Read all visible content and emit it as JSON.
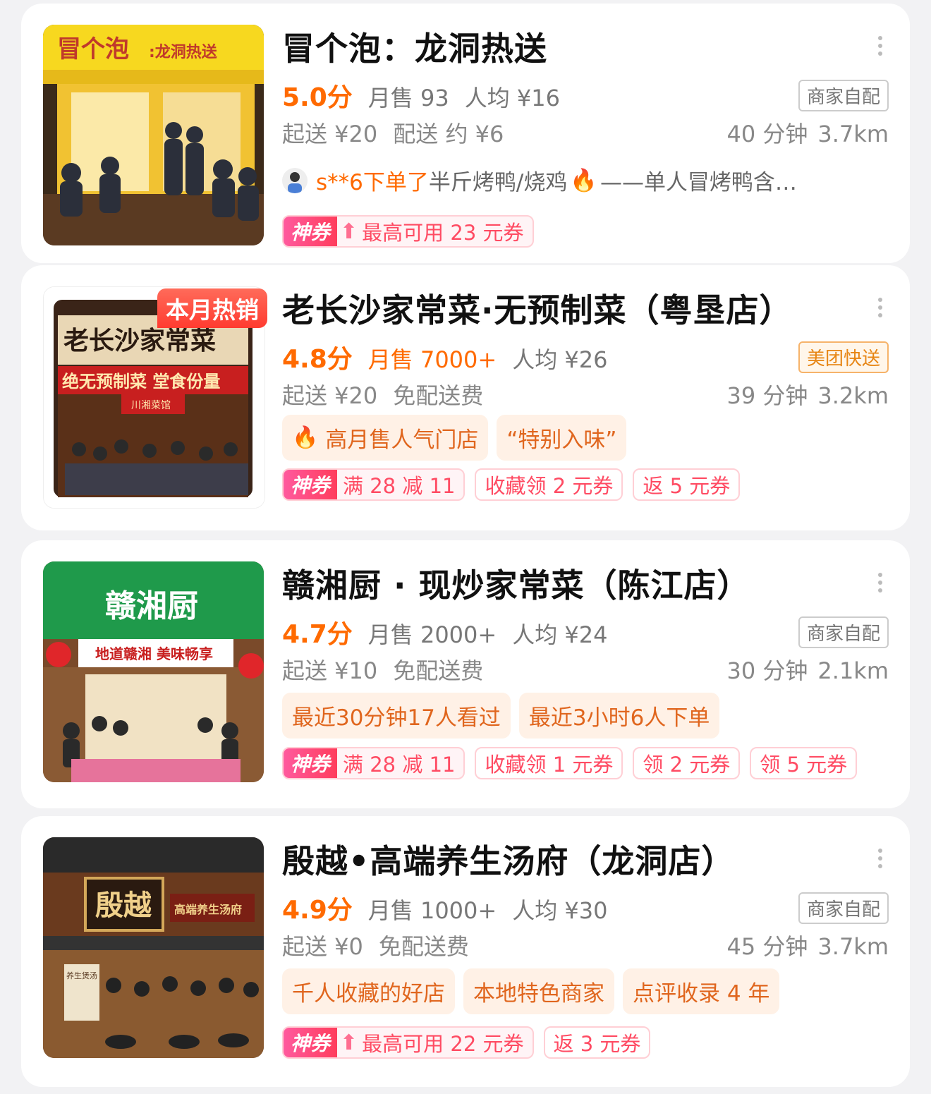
{
  "shops": [
    {
      "name": "冒个泡：龙洞热送",
      "score": "5.0分",
      "monthly_sales": "月售 93",
      "avg_price": "人均 ¥16",
      "delivery_type": "商家自配",
      "min_order": "起送 ¥20",
      "delivery_fee": "配送 约 ¥6",
      "time": "40 分钟",
      "distance": "3.7km",
      "feed": {
        "user": "s**6下单了",
        "text": "半斤烤鸭/烧鸡",
        "text2": "——单人冒烤鸭含…"
      },
      "coupons": [
        {
          "god": true,
          "label": "神券",
          "text": "最高可用 23 元券"
        }
      ],
      "image": {
        "sign": "冒个泡",
        "sign_sub": ":龙洞热送"
      }
    },
    {
      "name": "老长沙家常菜·无预制菜（粤垦店）",
      "score": "4.8分",
      "monthly_sales": "月售 7000+",
      "avg_price": "人均 ¥26",
      "delivery_type": "美团快送",
      "min_order": "起送 ¥20",
      "delivery_fee": "免配送费",
      "time": "39 分钟",
      "distance": "3.2km",
      "badge": "本月热销",
      "features": [
        "高月售人气门店",
        "“特别入味”"
      ],
      "coupons": [
        {
          "god": true,
          "label": "神券",
          "text": "满 28 减 11"
        },
        {
          "god": false,
          "text": "收藏领 2 元券"
        },
        {
          "god": false,
          "text": "返 5 元券"
        }
      ],
      "image": {
        "sign": "老长沙家常菜",
        "banner": "绝无预制菜 堂食份量",
        "small_sign": "川湘菜馆"
      }
    },
    {
      "name": "赣湘厨 · 现炒家常菜（陈江店）",
      "score": "4.7分",
      "monthly_sales": "月售 2000+",
      "avg_price": "人均 ¥24",
      "delivery_type": "商家自配",
      "min_order": "起送 ¥10",
      "delivery_fee": "免配送费",
      "time": "30 分钟",
      "distance": "2.1km",
      "features": [
        "最近30分钟17人看过",
        "最近3小时6人下单"
      ],
      "coupons": [
        {
          "god": true,
          "label": "神券",
          "text": "满 28 减 11"
        },
        {
          "god": false,
          "text": "收藏领 1 元券"
        },
        {
          "god": false,
          "text": "领 2 元券"
        },
        {
          "god": false,
          "text": "领 5 元券"
        }
      ],
      "image": {
        "sign": "赣湘厨",
        "banner": "地道赣湘 美味畅享"
      }
    },
    {
      "name": "殷越•高端养生汤府（龙洞店）",
      "score": "4.9分",
      "monthly_sales": "月售 1000+",
      "avg_price": "人均 ¥30",
      "delivery_type": "商家自配",
      "min_order": "起送 ¥0",
      "delivery_fee": "免配送费",
      "time": "45 分钟",
      "distance": "3.7km",
      "features": [
        "千人收藏的好店",
        "本地特色商家",
        "点评收录 4 年"
      ],
      "coupons": [
        {
          "god": true,
          "label": "神券",
          "text": "最高可用 22 元券"
        },
        {
          "god": false,
          "text": "返 3 元券"
        }
      ],
      "image": {
        "sign": "殷越",
        "sign_side": "高端养生汤府",
        "poster": "养生煲汤"
      }
    }
  ],
  "colors": {
    "accent": "#ff6a00",
    "coupon": "#ff4b63",
    "muted": "#888888"
  },
  "icons": [
    "more-icon",
    "flame-icon",
    "arrow-up-icon"
  ]
}
